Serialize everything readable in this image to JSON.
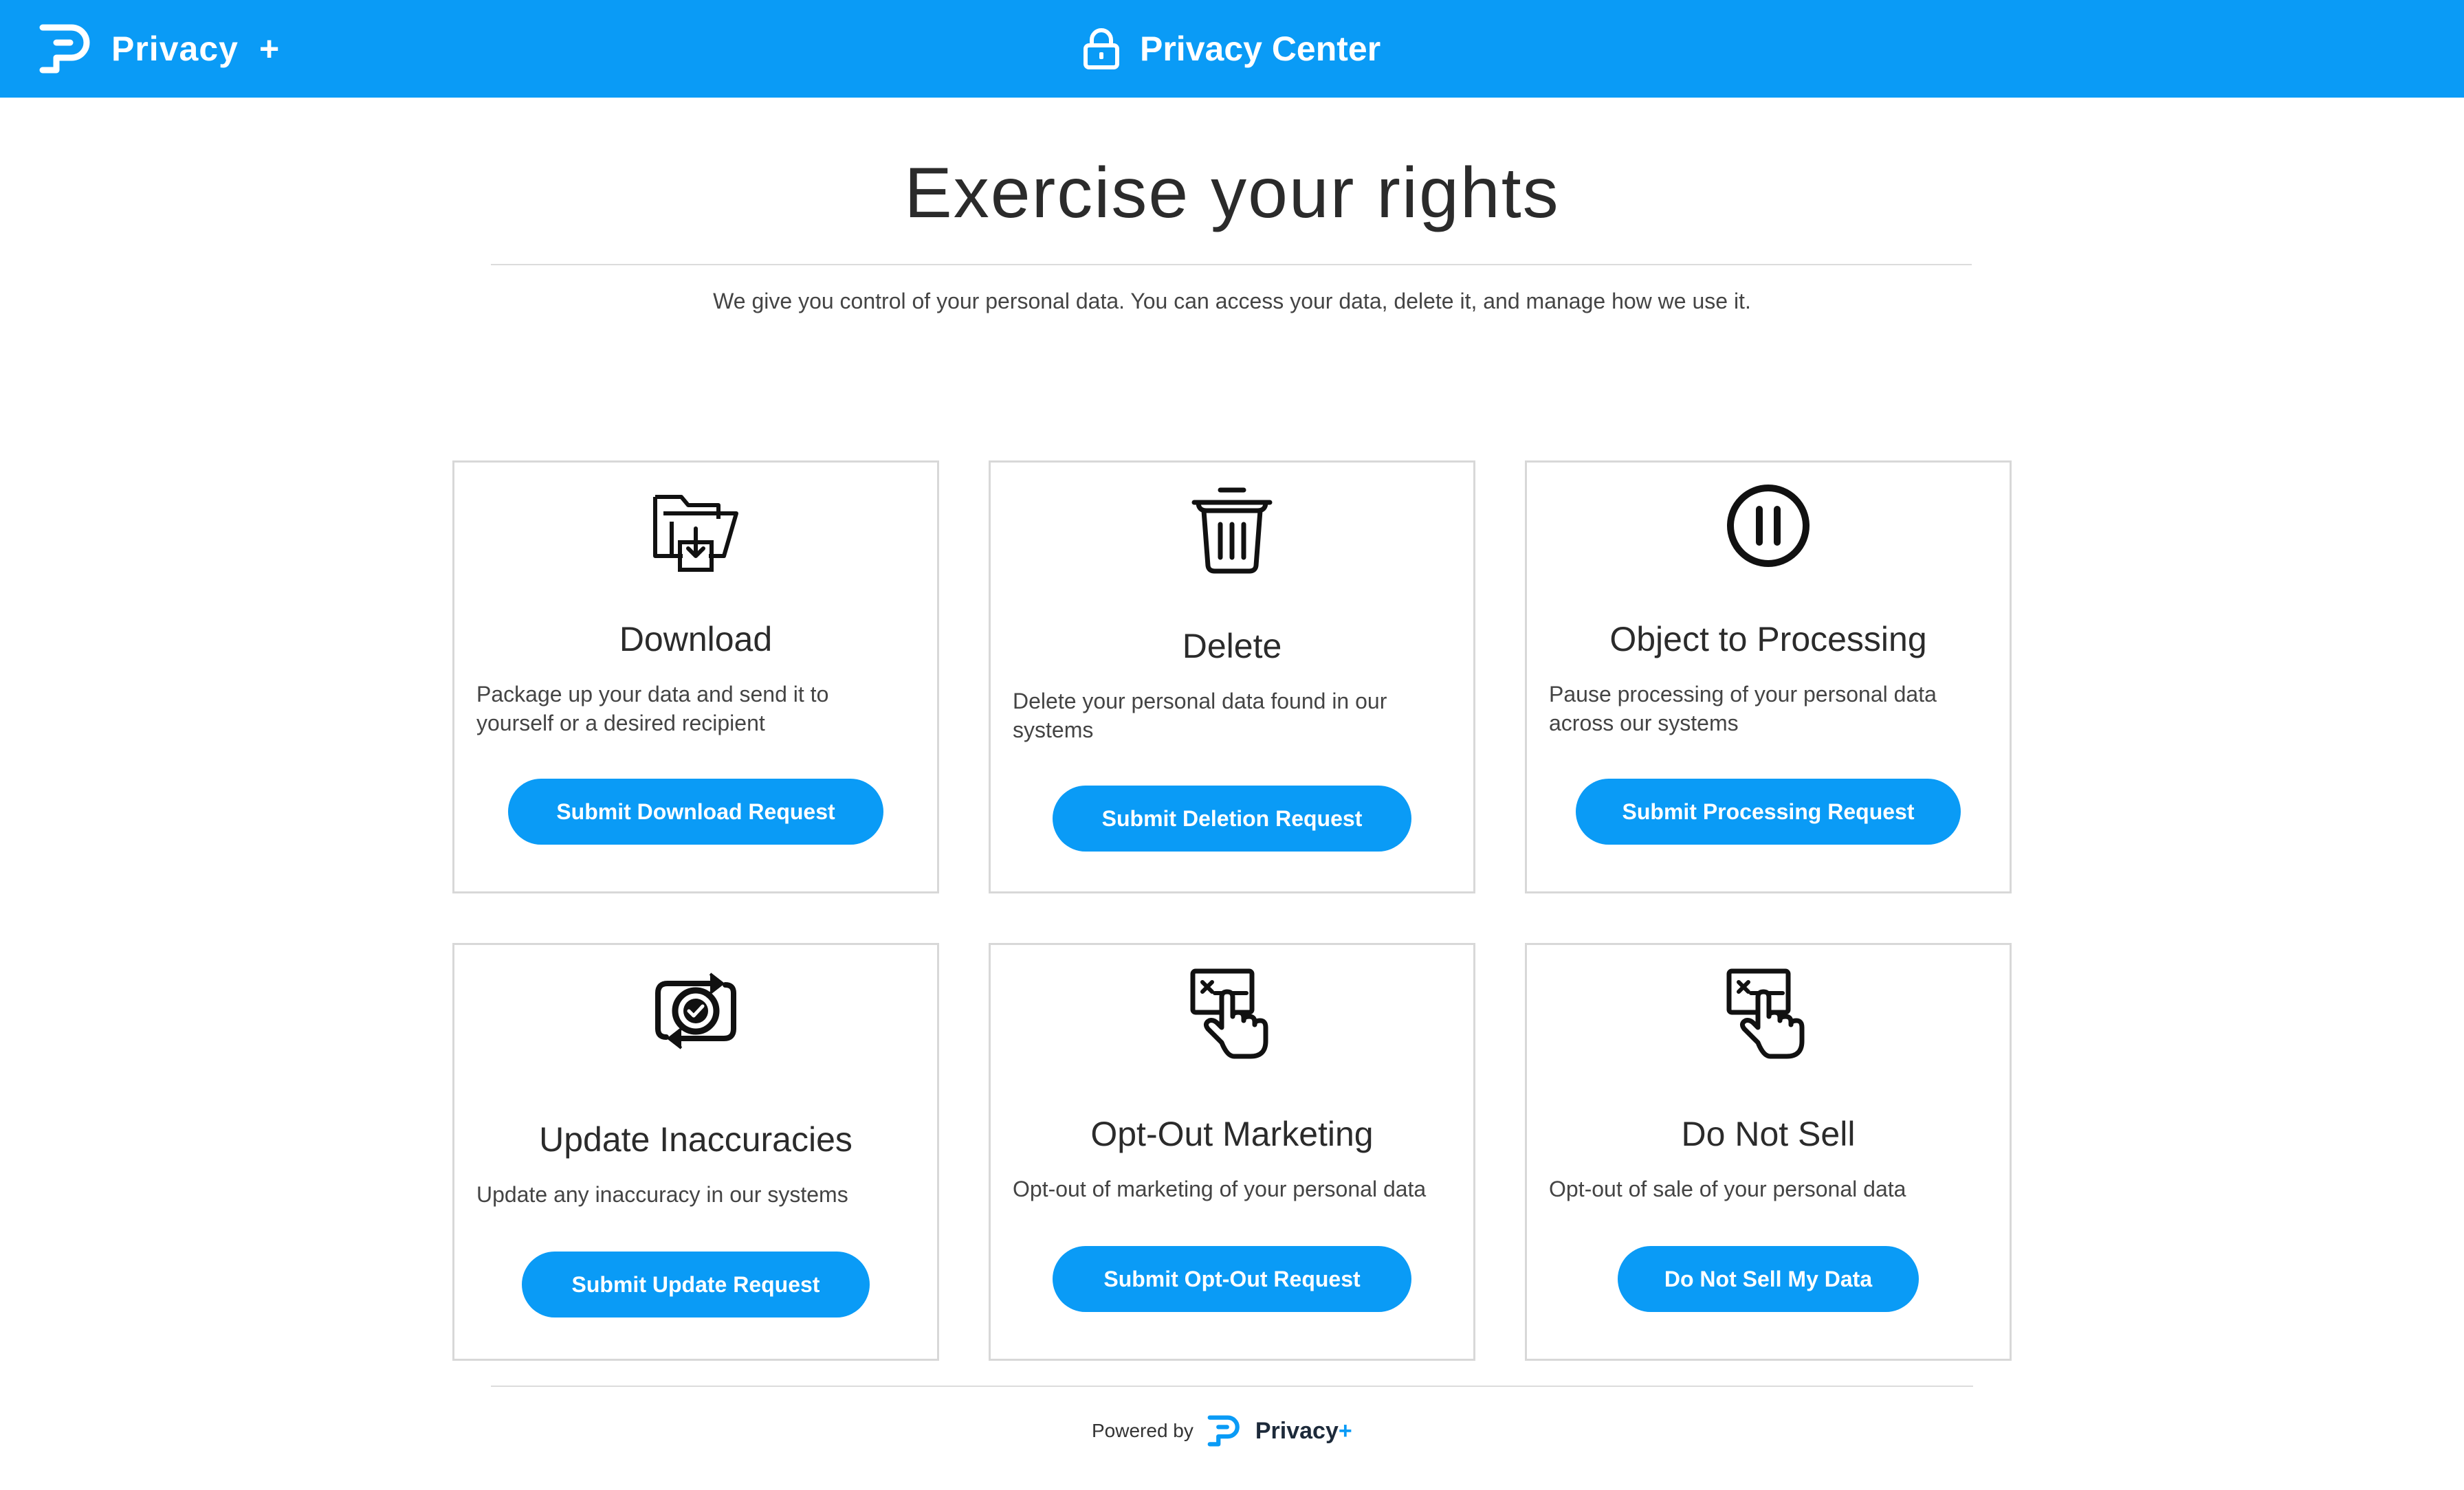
{
  "header": {
    "brand_name": "Privacy",
    "brand_plus": "+",
    "title": "Privacy Center"
  },
  "hero": {
    "title": "Exercise your rights",
    "subtitle": "We give you control of your personal data. You can access your data, delete it, and manage how we use it."
  },
  "cards": [
    {
      "icon": "folder-download-icon",
      "title": "Download",
      "desc": "Package up your data and send it to yourself or a desired recipient",
      "button": "Submit Download Request"
    },
    {
      "icon": "trash-icon",
      "title": "Delete",
      "desc": "Delete your personal data found in our systems",
      "button": "Submit Deletion Request"
    },
    {
      "icon": "pause-icon",
      "title": "Object to Processing",
      "desc": "Pause processing of your personal data across our systems",
      "button": "Submit Processing Request"
    },
    {
      "icon": "refresh-check-icon",
      "title": "Update Inaccuracies",
      "desc": "Update any inaccuracy in our systems",
      "button": "Submit Update Request"
    },
    {
      "icon": "tap-close-icon",
      "title": "Opt-Out Marketing",
      "desc": "Opt-out of marketing of your personal data",
      "button": "Submit Opt-Out Request"
    },
    {
      "icon": "tap-close-icon",
      "title": "Do Not Sell",
      "desc": "Opt-out of sale of your personal data",
      "button": "Do Not Sell My Data"
    }
  ],
  "footer": {
    "powered_by": "Powered by",
    "brand_name": "Privacy",
    "brand_plus": "+"
  },
  "colors": {
    "primary": "#0a9bf6",
    "header_text": "#ffffff",
    "border": "#d8d8d8",
    "footer_brand": "#1d2a3a"
  }
}
